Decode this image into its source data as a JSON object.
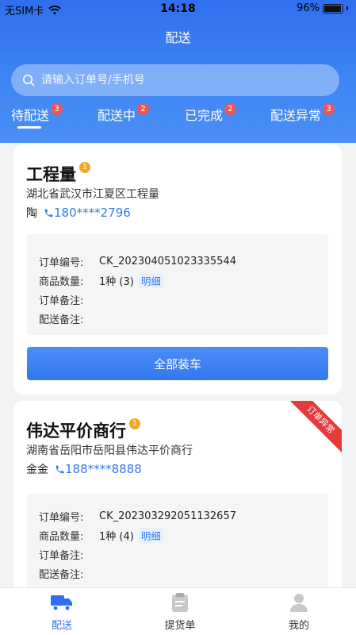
{
  "status_bar": {
    "carrier": "无SIM卡",
    "time": "14:18",
    "battery": "96%",
    "battery_level": 0.96
  },
  "header": {
    "title": "配送"
  },
  "search": {
    "placeholder": "请输入订单号/手机号"
  },
  "tabs": [
    {
      "label": "待配送",
      "badge": "3",
      "active": true
    },
    {
      "label": "配送中",
      "badge": "2"
    },
    {
      "label": "已完成",
      "badge": "2"
    },
    {
      "label": "配送异常",
      "badge": "3"
    }
  ],
  "orders": [
    {
      "shop_name": "工程量",
      "badge": "1",
      "address": "湖北省武汉市江夏区工程量",
      "contact_name": "陶",
      "phone": "180****2796",
      "order_no_label": "订单编号:",
      "order_no": "CK_202304051023335544",
      "qty_label": "商品数量:",
      "qty": "1种 (3)",
      "detail_link": "明细",
      "order_note_label": "订单备注:",
      "delivery_note_label": "配送备注:",
      "action": "全部装车"
    },
    {
      "shop_name": "伟达平价商行",
      "badge": "1",
      "address": "湖南省岳阳市岳阳县伟达平价商行",
      "contact_name": "金金",
      "phone": "188****8888",
      "ribbon": "订单异常",
      "order_no_label": "订单编号:",
      "order_no": "CK_202303292051132657",
      "qty_label": "商品数量:",
      "qty": "1种 (4)",
      "detail_link": "明细",
      "order_note_label": "订单备注:",
      "delivery_note_label": "配送备注:"
    }
  ],
  "tab_bar": [
    {
      "label": "配送",
      "icon": "truck-icon",
      "active": true
    },
    {
      "label": "提货单",
      "icon": "clipboard-icon"
    },
    {
      "label": "我的",
      "icon": "user-icon"
    }
  ],
  "colors": {
    "primary": "#2f6ff0",
    "badge_red": "#f05555",
    "badge_orange": "#f5a623",
    "ribbon_red": "#e63b3b"
  }
}
